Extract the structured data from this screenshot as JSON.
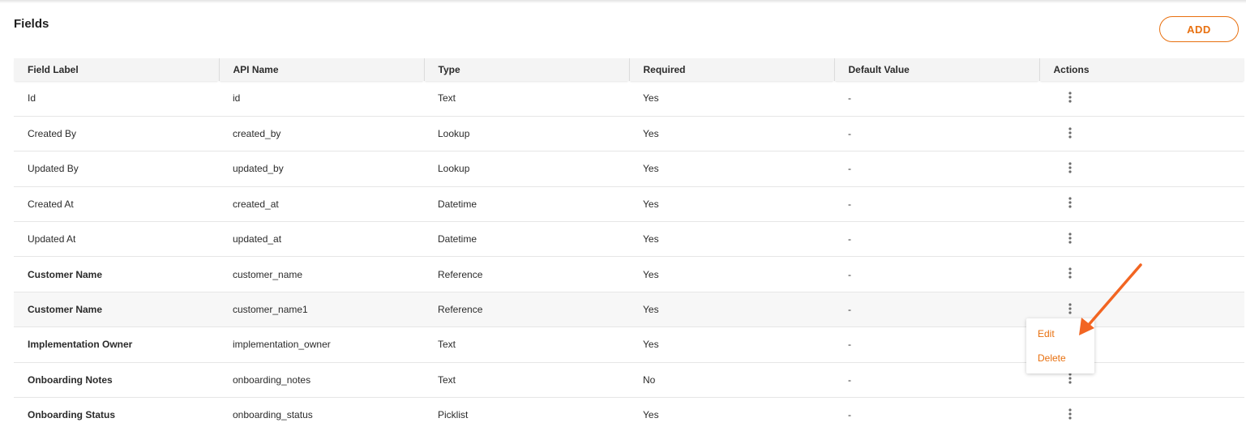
{
  "section": {
    "title": "Fields"
  },
  "toolbar": {
    "add_label": "ADD"
  },
  "table": {
    "columns": [
      "Field Label",
      "API Name",
      "Type",
      "Required",
      "Default Value",
      "Actions"
    ],
    "rows": [
      {
        "label": "Id",
        "api": "id",
        "type": "Text",
        "required": "Yes",
        "default": "-"
      },
      {
        "label": "Created By",
        "api": "created_by",
        "type": "Lookup",
        "required": "Yes",
        "default": "-"
      },
      {
        "label": "Updated By",
        "api": "updated_by",
        "type": "Lookup",
        "required": "Yes",
        "default": "-"
      },
      {
        "label": "Created At",
        "api": "created_at",
        "type": "Datetime",
        "required": "Yes",
        "default": "-"
      },
      {
        "label": "Updated At",
        "api": "updated_at",
        "type": "Datetime",
        "required": "Yes",
        "default": "-"
      },
      {
        "label": "Customer Name",
        "api": "customer_name",
        "type": "Reference",
        "required": "Yes",
        "default": "-"
      },
      {
        "label": "Customer Name",
        "api": "customer_name1",
        "type": "Reference",
        "required": "Yes",
        "default": "-"
      },
      {
        "label": "Implementation Owner",
        "api": "implementation_owner",
        "type": "Text",
        "required": "Yes",
        "default": "-"
      },
      {
        "label": "Onboarding Notes",
        "api": "onboarding_notes",
        "type": "Text",
        "required": "No",
        "default": "-"
      },
      {
        "label": "Onboarding Status",
        "api": "onboarding_status",
        "type": "Picklist",
        "required": "Yes",
        "default": "-"
      }
    ]
  },
  "context_menu": {
    "edit_label": "Edit",
    "delete_label": "Delete"
  },
  "icons": {
    "row_actions": "kebab-icon",
    "annotation": "arrow-icon"
  },
  "colors": {
    "accent": "#e8700f",
    "annotation_arrow": "#f26522",
    "header_bg": "#f4f4f4"
  }
}
